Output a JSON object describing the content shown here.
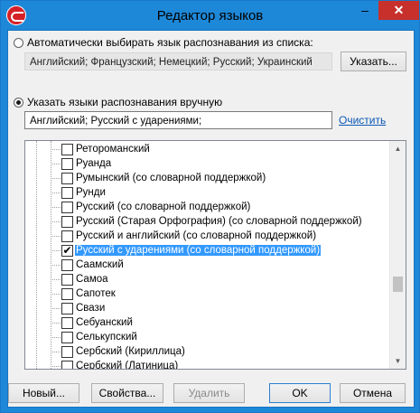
{
  "window": {
    "title": "Редактор языков",
    "minimize": "–",
    "close": "✕",
    "app_icon": "app-logo-icon"
  },
  "auto": {
    "label": "Автоматически выбирать язык распознавания из списка:",
    "selected": false,
    "field_value": "Английский; Французский; Немецкий; Русский; Украинский",
    "button": "Указать..."
  },
  "manual": {
    "label": "Указать языки распознавания вручную",
    "selected": true,
    "field_value": "Английский; Русский с ударениями;",
    "clear_link": "Очистить"
  },
  "languages": [
    {
      "label": "Ретороманский",
      "checked": false,
      "selected": false
    },
    {
      "label": "Руанда",
      "checked": false,
      "selected": false
    },
    {
      "label": "Румынский (со словарной поддержкой)",
      "checked": false,
      "selected": false
    },
    {
      "label": "Рунди",
      "checked": false,
      "selected": false
    },
    {
      "label": "Русский (со словарной поддержкой)",
      "checked": false,
      "selected": false
    },
    {
      "label": "Русский (Старая Орфография) (со словарной поддержкой)",
      "checked": false,
      "selected": false
    },
    {
      "label": "Русский и английский (со словарной поддержкой)",
      "checked": false,
      "selected": false
    },
    {
      "label": "Русский с ударениями (со словарной поддержкой)",
      "checked": true,
      "selected": true
    },
    {
      "label": "Саамский",
      "checked": false,
      "selected": false
    },
    {
      "label": "Самоа",
      "checked": false,
      "selected": false
    },
    {
      "label": "Сапотек",
      "checked": false,
      "selected": false
    },
    {
      "label": "Свази",
      "checked": false,
      "selected": false
    },
    {
      "label": "Себуанский",
      "checked": false,
      "selected": false
    },
    {
      "label": "Селькупский",
      "checked": false,
      "selected": false
    },
    {
      "label": "Сербский (Кириллица)",
      "checked": false,
      "selected": false
    },
    {
      "label": "Сербский (Латиница)",
      "checked": false,
      "selected": false
    }
  ],
  "scrollbar": {
    "up": "▲",
    "down": "▼"
  },
  "footer": {
    "new": "Новый...",
    "properties": "Свойства...",
    "delete": "Удалить",
    "ok": "OK",
    "cancel": "Отмена"
  }
}
